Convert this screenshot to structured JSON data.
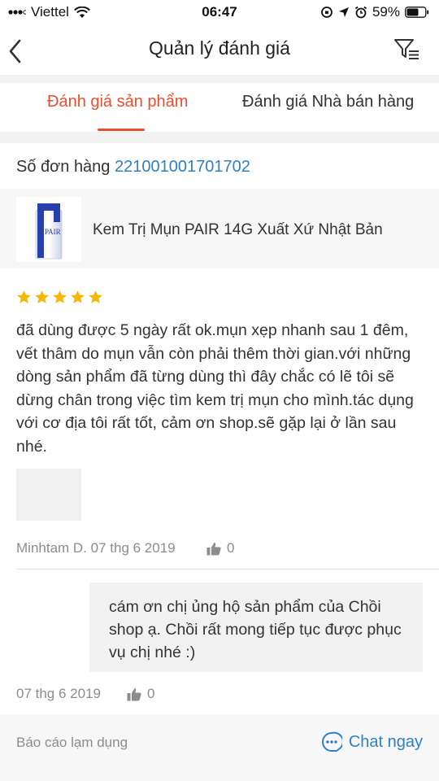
{
  "status_bar": {
    "carrier": "Viettel",
    "time": "06:47",
    "battery": "59%"
  },
  "header": {
    "title": "Quản lý đánh giá"
  },
  "tabs": [
    {
      "label": "Đánh giá sản phẩm",
      "active": true
    },
    {
      "label": "Đánh giá Nhà bán hàng",
      "active": false
    }
  ],
  "order": {
    "label": "Số đơn hàng",
    "number": "221001001701702"
  },
  "product": {
    "name": "Kem Trị Mụn PAIR 14G Xuất Xứ Nhật Bản",
    "thumb_text": "PAIR"
  },
  "review": {
    "rating": 5,
    "text": "đã dùng được 5 ngày rất ok.mụn xẹp nhanh sau 1 đêm, vết thâm do mụn vẫn còn phải thêm thời gian.với những dòng sản phẩm đã từng dùng thì đây chắc có lẽ tôi sẽ dừng chân trong việc tìm kem trị mụn cho mình.tác dụng với cơ địa tôi rất tốt, cảm ơn shop.sẽ gặp lại ở lần sau nhé.",
    "author_date": "Minhtam D. 07 thg 6 2019",
    "likes": "0"
  },
  "reply": {
    "text": "cám ơn chị ủng hộ sản phẩm của Chồi shop ạ. Chồi rất mong tiếp tục được phục vụ chị nhé :)",
    "date": "07 thg 6 2019",
    "likes": "0"
  },
  "footer": {
    "report_label": "Báo cáo lạm dụng",
    "chat_label": "Chat ngay"
  },
  "colors": {
    "accent": "#ee4d2d",
    "link": "#2f80c8",
    "star": "#f5b700"
  }
}
